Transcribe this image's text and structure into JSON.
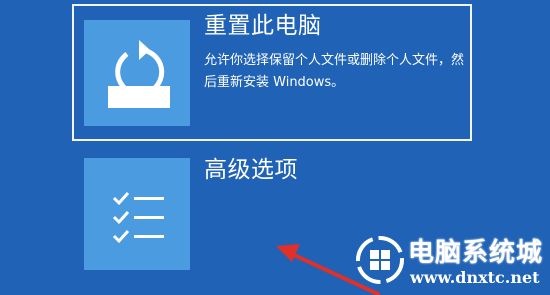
{
  "options": [
    {
      "title": "重置此电脑",
      "description": "允许你选择保留个人文件或删除个人文件，然后重新安装 Windows。",
      "icon": "reset-pc-icon",
      "selected": true
    },
    {
      "title": "高级选项",
      "icon": "checklist-icon",
      "selected": false
    }
  ],
  "watermark": {
    "title": "电脑系统城",
    "url": "www.dnxtc.net"
  },
  "colors": {
    "background": "#1f62b6",
    "tile": "#4a9be0",
    "arrow": "#e0302a"
  }
}
